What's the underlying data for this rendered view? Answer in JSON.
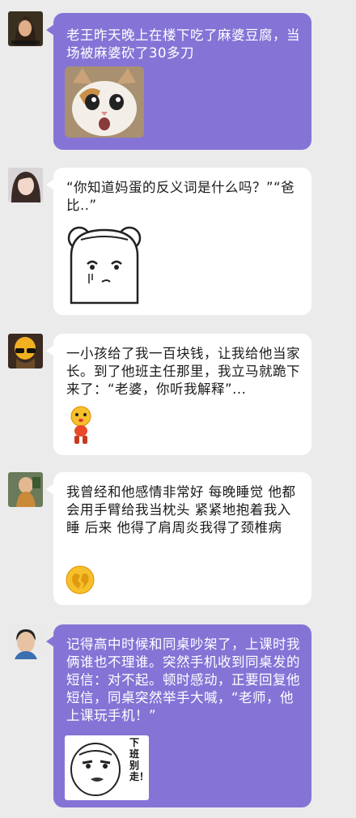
{
  "messages": [
    {
      "text": "老王昨天晚上在楼下吃了麻婆豆腐，当场被麻婆砍了30多刀",
      "sticker": "cat-face-sticker"
    },
    {
      "text": "“你知道妈蛋的反义词是什么吗？”“爸比..”",
      "sticker": "bear-face-sticker"
    },
    {
      "text": "一小孩给了我一百块钱，让我给他当家长。到了他班主任那里，我立马就跪下来了：“老婆，你听我解释”...",
      "sticker": "kneeling-emoji-sticker"
    },
    {
      "text": "我曾经和他感情非常好 每晚睡觉 他都会用手臂给我当枕头 紧紧地抱着我入睡 后来 他得了肩周炎我得了颈椎病",
      "sticker": "broken-heart-emoji-sticker"
    },
    {
      "text": "记得高中时候和同桌吵架了，上课时我俩谁也不理谁。突然手机收到同桌发的短信：对不起。顿时感动，正要回复他短信，同桌突然举手大喊，“老师，他上课玩手机！”",
      "sticker": "meme-face-sticker",
      "sticker_caption": "下班别走！"
    }
  ],
  "colors": {
    "background": "#ebebeb",
    "bubble_purple": "#8574d6",
    "bubble_white": "#ffffff"
  }
}
